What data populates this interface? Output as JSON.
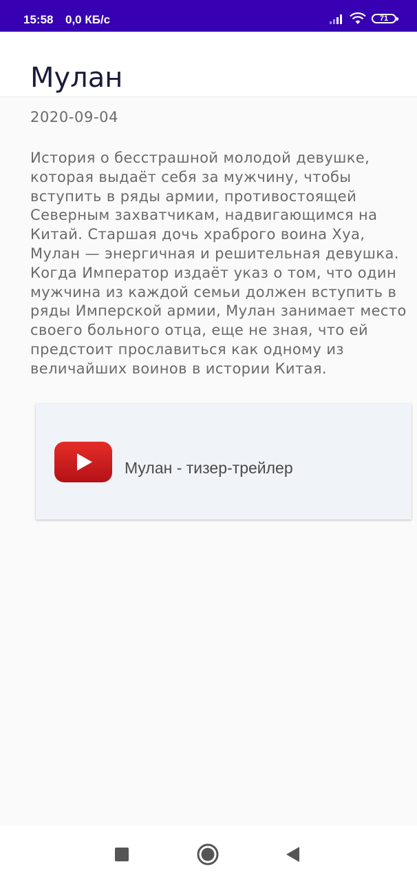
{
  "status_bar": {
    "time": "15:58",
    "network_speed": "0,0 КБ/с",
    "battery_level": "71",
    "icons": [
      "signal-icon",
      "wifi-icon",
      "battery-icon"
    ],
    "background_color": "#3700b3"
  },
  "header": {
    "title": "Мулан"
  },
  "movie": {
    "release_date": "2020-09-04",
    "description": "История о бесстрашной молодой девушке, которая выдаёт себя за мужчину, чтобы вступить в ряды армии, противостоящей Северным захватчикам, надвигающимся на Китай. Старшая дочь храброго воина Хуа, Мулан — энергичная и решительная девушка. Когда Император издаёт указ о том, что один мужчина из каждой семьи должен вступить в ряды Имперской армии, Мулан занимает место своего больного отца, еще не зная, что ей предстоит прославиться как одному из величайших воинов в истории Китая."
  },
  "videos": [
    {
      "title": "Мулан - тизер-трейлер",
      "icon": "youtube-icon",
      "accent_color": "#d3231e"
    }
  ],
  "nav_bar": {
    "buttons": [
      "recents-square-icon",
      "home-circle-icon",
      "back-triangle-icon"
    ]
  }
}
